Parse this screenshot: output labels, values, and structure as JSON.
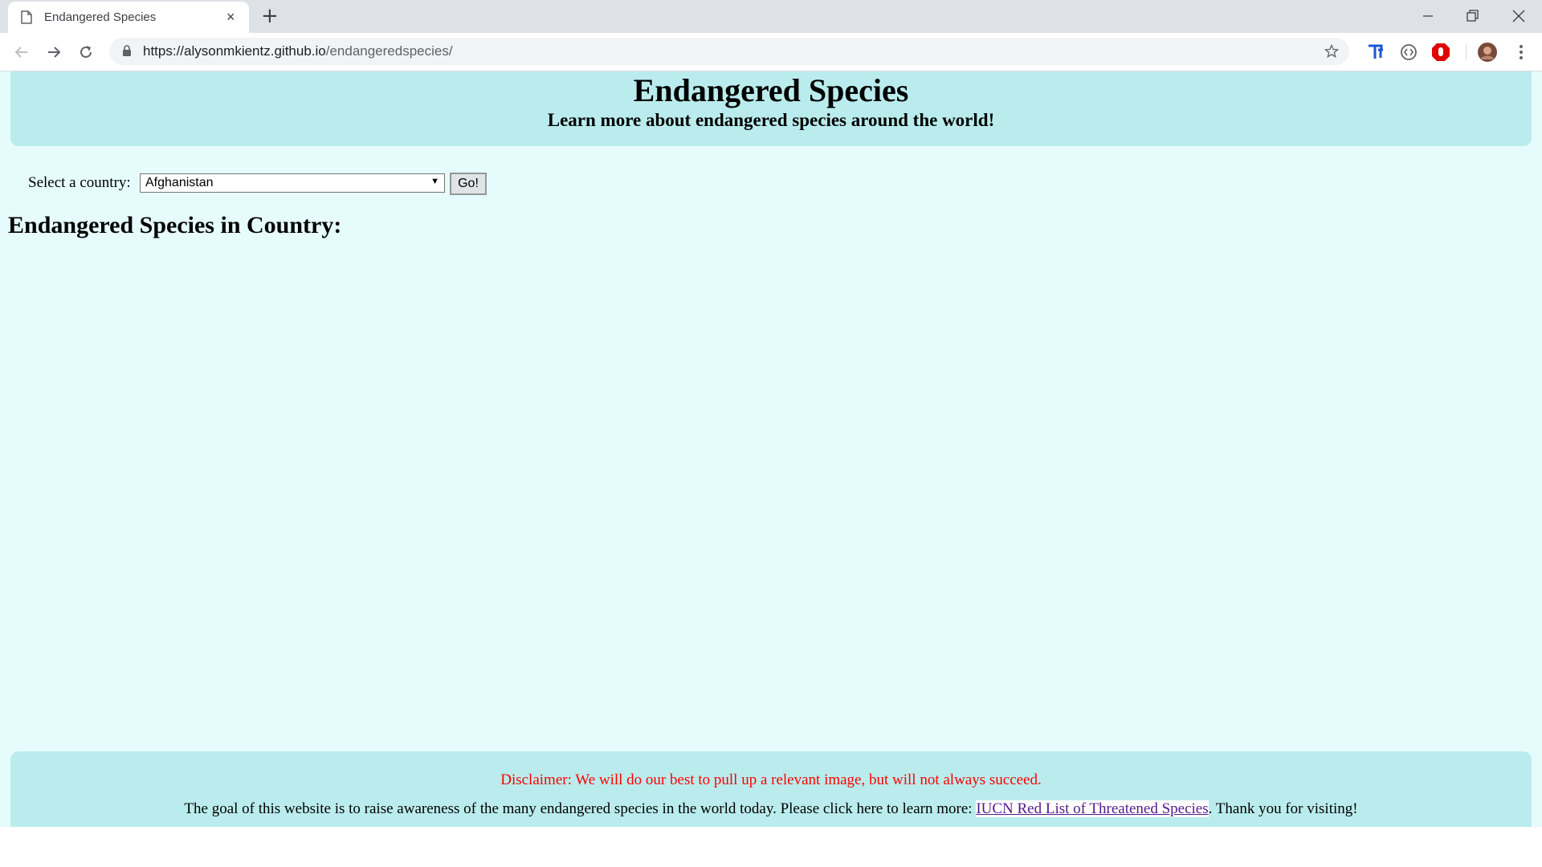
{
  "browser": {
    "tab": {
      "title": "Endangered Species",
      "close": "×"
    },
    "new_tab": "+",
    "url": {
      "host": "https://alysonmkientz.github.io",
      "path": "/endangeredspecies/"
    }
  },
  "header": {
    "title": "Endangered Species",
    "subtitle": "Learn more about endangered species around the world!"
  },
  "form": {
    "label": "Select a country:",
    "selected_country": "Afghanistan",
    "dropdown_arrow": "▼",
    "go_label": "Go!"
  },
  "results": {
    "heading": "Endangered Species in Country:"
  },
  "footer": {
    "disclaimer": "Disclaimer: We will do our best to pull up a relevant image, but will not always succeed.",
    "goal_prefix": "The goal of this website is to raise awareness of the many endangered species in the world today. Please click here to learn more: ",
    "link_text": "IUCN Red List of Threatened Species",
    "goal_suffix": ". Thank you for visiting!"
  },
  "icons": [
    "document-icon",
    "tab-close-icon",
    "new-tab-icon",
    "minimize-icon",
    "restore-icon",
    "window-close-icon",
    "back-arrow-icon",
    "forward-arrow-icon",
    "reload-icon",
    "lock-icon",
    "bookmark-star-icon",
    "translate-extension-icon",
    "code-extension-icon",
    "adblock-extension-icon",
    "profile-avatar-icon",
    "chrome-menu-icon"
  ],
  "colors": {
    "page_background": "#e6fcfc",
    "banner_background": "#baeced",
    "disclaimer_text": "#ff0000",
    "link": "#551a8b"
  }
}
